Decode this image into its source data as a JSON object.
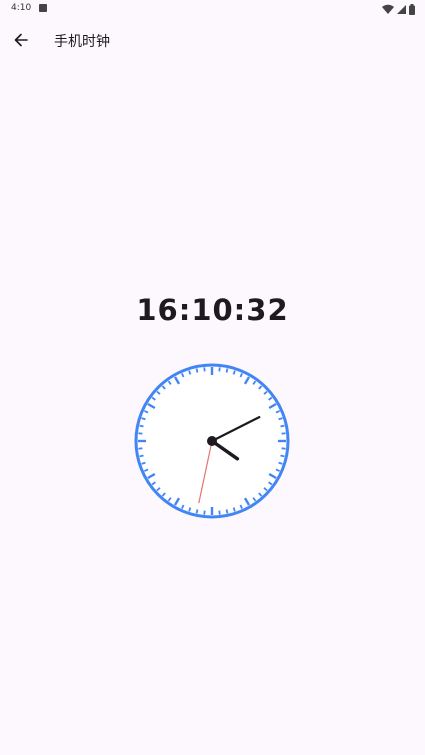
{
  "status_bar": {
    "time": "4:10",
    "icons": [
      "notification-a-icon",
      "wifi-icon",
      "signal-icon",
      "battery-icon"
    ]
  },
  "app_bar": {
    "back_icon": "arrow-left-icon",
    "title": "手机时钟"
  },
  "clock": {
    "digital_time": "16:10:32",
    "hours": 16,
    "minutes": 10,
    "seconds": 32,
    "ring_color": "#4285f4",
    "tick_color": "#4285f4",
    "hand_color": "#1d1b20",
    "second_hand_color": "#e57373",
    "face_color": "#ffffff"
  }
}
